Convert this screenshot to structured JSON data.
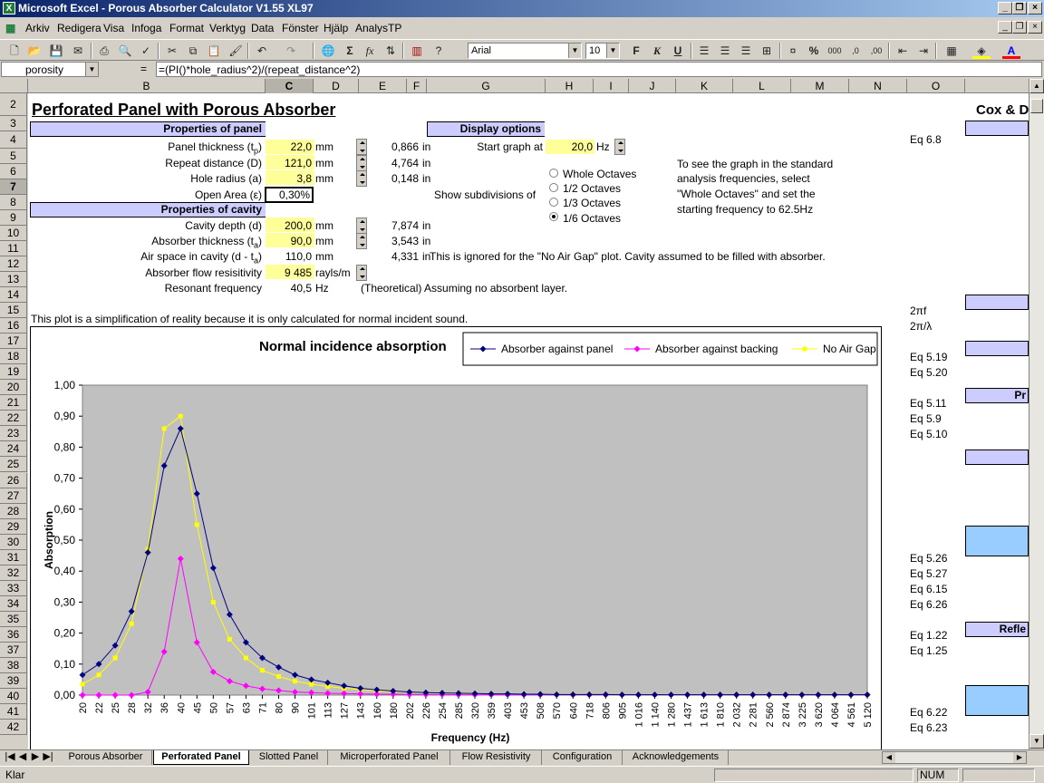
{
  "window": {
    "title": "Microsoft Excel - Porous Absorber Calculator V1.55 XL97"
  },
  "menu": [
    "Arkiv",
    "Redigera",
    "Visa",
    "Infoga",
    "Format",
    "Verktyg",
    "Data",
    "Fönster",
    "Hjälp",
    "AnalysTP"
  ],
  "toolbar": {
    "font": "Arial",
    "size": "10"
  },
  "formula": {
    "name": "porosity",
    "eq": "=",
    "text": "=(PI()*hole_radius^2)/(repeat_distance^2)"
  },
  "columns": [
    "B",
    "C",
    "D",
    "E",
    "F",
    "G",
    "H",
    "I",
    "J",
    "K",
    "L",
    "M",
    "N",
    "O"
  ],
  "rows": [
    "2",
    "3",
    "4",
    "5",
    "6",
    "7",
    "8",
    "9",
    "10",
    "11",
    "12",
    "13",
    "14",
    "15",
    "16",
    "17",
    "18",
    "19",
    "20",
    "21",
    "22",
    "23",
    "24",
    "25",
    "26",
    "27",
    "28",
    "29",
    "30",
    "31",
    "32",
    "33",
    "34",
    "35",
    "36",
    "37",
    "38",
    "39",
    "40",
    "41",
    "42"
  ],
  "sheet": {
    "title": "Perforated Panel with Porous Absorber",
    "right_title": "Cox & D",
    "props_panel": "Properties of panel",
    "display_options": "Display options",
    "props_cavity": "Properties of cavity",
    "panel_thickness": {
      "label": "Panel thickness (t",
      "sub": "p",
      "close": ")",
      "value": "22,0",
      "unit": "mm",
      "conv": "0,866",
      "conv_unit": "in"
    },
    "repeat_distance": {
      "label": "Repeat distance (D)",
      "value": "121,0",
      "unit": "mm",
      "conv": "4,764",
      "conv_unit": "in"
    },
    "hole_radius": {
      "label": "Hole radius (a)",
      "value": "3,8",
      "unit": "mm",
      "conv": "0,148",
      "conv_unit": "in"
    },
    "open_area": {
      "label": "Open Area (ε)",
      "value": "0,30%"
    },
    "cavity_depth": {
      "label": "Cavity depth (d)",
      "value": "200,0",
      "unit": "mm",
      "conv": "7,874",
      "conv_unit": "in"
    },
    "absorber_thickness": {
      "label": "Absorber thickness (t",
      "sub": "a",
      "close": ")",
      "value": "90,0",
      "unit": "mm",
      "conv": "3,543",
      "conv_unit": "in"
    },
    "air_space": {
      "label": "Air space in cavity (d - t",
      "sub": "a",
      "close": ")",
      "value": "110,0",
      "unit": "mm",
      "conv": "4,331",
      "conv_unit": "in"
    },
    "flow_resistivity": {
      "label": "Absorber flow resisitivity",
      "value": "9 485",
      "unit": "rayls/m"
    },
    "resonant": {
      "label": "Resonant frequency",
      "value": "40,5",
      "unit": "Hz",
      "note": "(Theoretical) Assuming no absorbent layer."
    },
    "start_graph": {
      "label": "Start graph at",
      "value": "20,0",
      "unit": "Hz"
    },
    "subdivisions_label": "Show subdivisions of",
    "subdivisions": [
      "Whole Octaves",
      "1/2 Octaves",
      "1/3 Octaves",
      "1/6 Octaves"
    ],
    "hint": [
      "To see the graph in the standard",
      "analysis frequencies, select",
      "\"Whole Octaves\" and set the",
      "starting frequency to 62.5Hz"
    ],
    "ignored_note": "This is ignored for the \"No Air Gap\" plot.  Cavity assumed to be filled with absorber.",
    "simplification_note": "This plot is a simplification of reality because it is only calculated for normal incident sound.",
    "eq_refs": [
      {
        "row": 4,
        "text": "Eq 6.8"
      },
      {
        "row": 15,
        "text": "2πf"
      },
      {
        "row": 16,
        "text": "2π/λ"
      },
      {
        "row": 18,
        "text": "Eq 5.19"
      },
      {
        "row": 19,
        "text": "Eq 5.20"
      },
      {
        "row": 21,
        "text": "Eq 5.11"
      },
      {
        "row": 22,
        "text": "Eq 5.9"
      },
      {
        "row": 23,
        "text": "Eq 5.10"
      },
      {
        "row": 31,
        "text": "Eq 5.26"
      },
      {
        "row": 32,
        "text": "Eq 5.27"
      },
      {
        "row": 33,
        "text": "Eq 6.15"
      },
      {
        "row": 34,
        "text": "Eq 6.26"
      },
      {
        "row": 36,
        "text": "Eq 1.22"
      },
      {
        "row": 37,
        "text": "Eq 1.25"
      },
      {
        "row": 41,
        "text": "Eq 6.22"
      },
      {
        "row": 42,
        "text": "Eq 6.23"
      }
    ],
    "right_labels": [
      {
        "row": 20,
        "text": "Pr"
      },
      {
        "row": 35,
        "text": "Refle"
      }
    ]
  },
  "colors": {
    "series1": "#000080",
    "series2": "#ff00ff",
    "series3": "#ffff00",
    "plot_bg": "#c0c0c0",
    "input": "#ffff99",
    "header": "#ccccff"
  },
  "chart_data": {
    "type": "line",
    "title": "Normal incidence absorption",
    "xlabel": "Frequency (Hz)",
    "ylabel": "Absorption",
    "ylim": [
      0,
      1
    ],
    "yticks": [
      "0,00",
      "0,10",
      "0,20",
      "0,30",
      "0,40",
      "0,50",
      "0,60",
      "0,70",
      "0,80",
      "0,90",
      "1,00"
    ],
    "categories": [
      "20",
      "22",
      "25",
      "28",
      "32",
      "36",
      "40",
      "45",
      "50",
      "57",
      "63",
      "71",
      "80",
      "90",
      "101",
      "113",
      "127",
      "143",
      "160",
      "180",
      "202",
      "226",
      "254",
      "285",
      "320",
      "359",
      "403",
      "453",
      "508",
      "570",
      "640",
      "718",
      "806",
      "905",
      "1 016",
      "1 140",
      "1 280",
      "1 437",
      "1 613",
      "1 810",
      "2 032",
      "2 281",
      "2 560",
      "2 874",
      "3 225",
      "3 620",
      "4 064",
      "4 561",
      "5 120"
    ],
    "series": [
      {
        "name": "Absorber against panel",
        "color": "#000080",
        "marker": "diamond",
        "values": [
          0.065,
          0.1,
          0.16,
          0.27,
          0.46,
          0.74,
          0.86,
          0.65,
          0.41,
          0.26,
          0.17,
          0.12,
          0.09,
          0.065,
          0.05,
          0.04,
          0.03,
          0.022,
          0.017,
          0.013,
          0.01,
          0.008,
          0.007,
          0.006,
          0.005,
          0.004,
          0.004,
          0.003,
          0.003,
          0.002,
          0.002,
          0.002,
          0.002,
          0.001,
          0.001,
          0.001,
          0.001,
          0.001,
          0.001,
          0.001,
          0.001,
          0.001,
          0.001,
          0.001,
          0.001,
          0.001,
          0.001,
          0.001,
          0.001
        ]
      },
      {
        "name": "Absorber against backing",
        "color": "#ff00ff",
        "marker": "diamond",
        "values": [
          0,
          0,
          0,
          0,
          0.01,
          0.14,
          0.44,
          0.17,
          0.075,
          0.045,
          0.03,
          0.02,
          0.015,
          0.01,
          0.008,
          0.006,
          0.005,
          0.004,
          0.003,
          0.003,
          0.002,
          0.002,
          0.002,
          0.001,
          0.001,
          0.001,
          0.001,
          0.001,
          0.001,
          0.001,
          0.001,
          0.001,
          0.001,
          0.001,
          0.001,
          0.001,
          0.001,
          0.001,
          0.001,
          0.001,
          0.001,
          0.001,
          0.001,
          0.001,
          0.001,
          0.001,
          0.001,
          0.001,
          0.001
        ]
      },
      {
        "name": "No Air Gap",
        "color": "#ffff00",
        "marker": "square",
        "values": [
          0.035,
          0.065,
          0.12,
          0.23,
          0.47,
          0.86,
          0.9,
          0.55,
          0.3,
          0.18,
          0.12,
          0.08,
          0.06,
          0.045,
          0.035,
          0.028,
          0.022,
          0.018,
          0.014,
          0.011,
          0.009,
          0.007,
          0.006,
          0.005,
          0.004,
          0.004,
          0.003,
          0.003,
          0.002,
          0.002,
          0.002,
          0.002,
          0.001,
          0.001,
          0.001,
          0.001,
          0.001,
          0.001,
          0.001,
          0.001,
          0.001,
          0.001,
          0.001,
          0.001,
          0.001,
          0.001,
          0.001,
          0.001,
          0.001
        ]
      }
    ],
    "legend": "top-right",
    "grid": false
  },
  "tabs": [
    "Porous Absorber",
    "Perforated Panel",
    "Slotted Panel",
    "Microperforated Panel",
    "Flow Resistivity",
    "Configuration",
    "Acknowledgements"
  ],
  "active_tab": "Perforated Panel",
  "status": {
    "left": "Klar",
    "num": "NUM"
  }
}
